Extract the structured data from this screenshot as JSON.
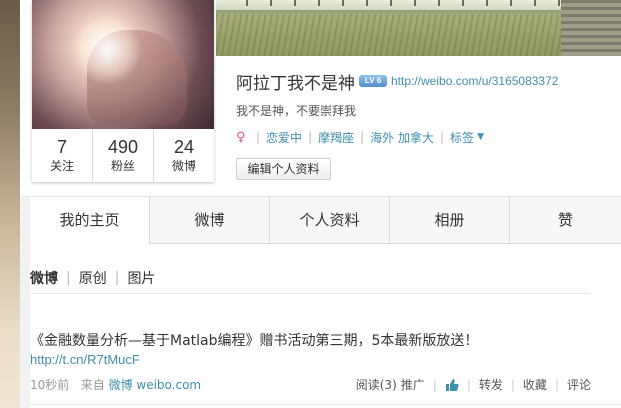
{
  "profile": {
    "username": "阿拉丁我不是神",
    "level_badge": "LV 6",
    "profile_url": "http://weibo.com/u/3165083372",
    "bio": "我不是神，不要崇拜我",
    "tags": [
      "恋爱中",
      "摩羯座",
      "海外 加拿大",
      "标签"
    ],
    "edit_button": "编辑个人资料"
  },
  "stats": [
    {
      "value": "7",
      "label": "关注"
    },
    {
      "value": "490",
      "label": "粉丝"
    },
    {
      "value": "24",
      "label": "微博"
    }
  ],
  "tabs": [
    "我的主页",
    "微博",
    "个人资料",
    "相册",
    "赞"
  ],
  "active_tab": "我的主页",
  "filters": [
    "微博",
    "原创",
    "图片"
  ],
  "post": {
    "text": "《金融数量分析—基于Matlab编程》赠书活动第三期，5本最新版放送！",
    "link": "http://t.cn/R7tMucF",
    "time": "10秒前",
    "source_prefix": "来自",
    "source": "微博 weibo.com",
    "actions": {
      "read": "阅读(3)",
      "promote": "推广",
      "repost": "转发",
      "favorite": "收藏",
      "comment": "评论"
    }
  },
  "icons": {
    "gender": "female-icon",
    "like": "thumbs-up-icon",
    "dropdown": "caret-down-icon"
  },
  "colors": {
    "link": "#3e8fab",
    "level_badge": "#4f8fcb",
    "gender_icon": "#d25c9b"
  }
}
